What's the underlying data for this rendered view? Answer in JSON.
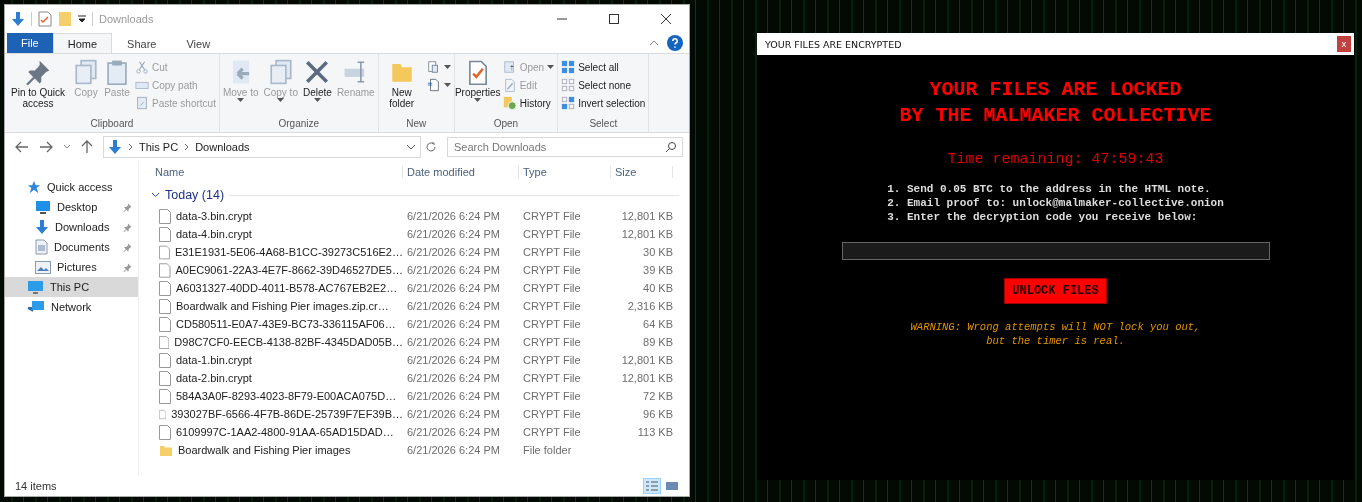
{
  "explorer": {
    "title": "Downloads",
    "tabs": [
      {
        "label": "File",
        "kind": "file",
        "selected": false
      },
      {
        "label": "Home",
        "kind": "tab",
        "selected": true
      },
      {
        "label": "Share",
        "kind": "tab",
        "selected": false
      },
      {
        "label": "View",
        "kind": "tab",
        "selected": false
      }
    ],
    "ribbon": [
      {
        "label": "Clipboard",
        "items": [
          {
            "kind": "large",
            "label": "Pin to Quick access",
            "disabled": false,
            "dropdown": false
          },
          {
            "kind": "large",
            "label": "Copy",
            "disabled": true,
            "dropdown": false
          },
          {
            "kind": "large",
            "label": "Paste",
            "disabled": true,
            "dropdown": false
          },
          {
            "kind": "small",
            "label": "Cut",
            "disabled": true,
            "dropdown": false
          },
          {
            "kind": "small",
            "label": "Copy path",
            "disabled": true,
            "dropdown": false
          },
          {
            "kind": "small",
            "label": "Paste shortcut",
            "disabled": true,
            "dropdown": false
          }
        ]
      },
      {
        "label": "Organize",
        "items": [
          {
            "kind": "large",
            "label": "Move to",
            "disabled": true,
            "dropdown": true
          },
          {
            "kind": "large",
            "label": "Copy to",
            "disabled": true,
            "dropdown": true
          },
          {
            "kind": "large",
            "label": "Delete",
            "disabled": false,
            "dropdown": true
          },
          {
            "kind": "large",
            "label": "Rename",
            "disabled": true,
            "dropdown": false
          }
        ]
      },
      {
        "label": "New",
        "items": [
          {
            "kind": "large",
            "label": "New folder",
            "disabled": false,
            "dropdown": false
          },
          {
            "kind": "icon",
            "disabled": false,
            "dropdown": true
          },
          {
            "kind": "icon",
            "disabled": false,
            "dropdown": true
          }
        ]
      },
      {
        "label": "Open",
        "items": [
          {
            "kind": "large",
            "label": "Properties",
            "disabled": false,
            "dropdown": true
          },
          {
            "kind": "small",
            "label": "Open",
            "disabled": true,
            "dropdown": true
          },
          {
            "kind": "small",
            "label": "Edit",
            "disabled": true,
            "dropdown": false
          },
          {
            "kind": "small",
            "label": "History",
            "disabled": false,
            "dropdown": false
          }
        ]
      },
      {
        "label": "Select",
        "items": [
          {
            "kind": "small",
            "label": "Select all",
            "disabled": false,
            "dropdown": false
          },
          {
            "kind": "small",
            "label": "Select none",
            "disabled": false,
            "dropdown": false
          },
          {
            "kind": "small",
            "label": "Invert selection",
            "disabled": false,
            "dropdown": false
          }
        ]
      }
    ],
    "address": {
      "crumbs": [
        "This PC",
        "Downloads"
      ]
    },
    "search": {
      "placeholder": "Search Downloads"
    },
    "nav": [
      {
        "label": "Quick access",
        "selected": false,
        "children": [
          {
            "label": "Desktop",
            "pinned": true,
            "selected": false
          },
          {
            "label": "Downloads",
            "pinned": true,
            "selected": false
          },
          {
            "label": "Documents",
            "pinned": true,
            "selected": false
          },
          {
            "label": "Pictures",
            "pinned": true,
            "selected": false
          }
        ]
      },
      {
        "label": "This PC",
        "selected": true
      },
      {
        "label": "Network",
        "selected": false
      }
    ],
    "columns": [
      "Name",
      "Date modified",
      "Type",
      "Size"
    ],
    "group": {
      "label": "Today (14)",
      "expanded": true
    },
    "rows": [
      {
        "kind": "file",
        "name": "data-3.bin.crypt",
        "date": "6/21/2026 6:24 PM",
        "type": "CRYPT File",
        "size": "12,801 KB"
      },
      {
        "kind": "file",
        "name": "data-4.bin.crypt",
        "date": "6/21/2026 6:24 PM",
        "type": "CRYPT File",
        "size": "12,801 KB"
      },
      {
        "kind": "file",
        "name": "E31E1931-5E06-4A68-B1CC-39273C516E2…",
        "date": "6/21/2026 6:24 PM",
        "type": "CRYPT File",
        "size": "30 KB"
      },
      {
        "kind": "file",
        "name": "A0EC9061-22A3-4E7F-8662-39D46527DE5…",
        "date": "6/21/2026 6:24 PM",
        "type": "CRYPT File",
        "size": "39 KB"
      },
      {
        "kind": "file",
        "name": "A6031327-40DD-4011-B578-AC767EB2E2…",
        "date": "6/21/2026 6:24 PM",
        "type": "CRYPT File",
        "size": "40 KB"
      },
      {
        "kind": "file",
        "name": "Boardwalk and Fishing Pier images.zip.cr…",
        "date": "6/21/2026 6:24 PM",
        "type": "CRYPT File",
        "size": "2,316 KB"
      },
      {
        "kind": "file",
        "name": "CD580511-E0A7-43E9-BC73-336115AF06…",
        "date": "6/21/2026 6:24 PM",
        "type": "CRYPT File",
        "size": "64 KB"
      },
      {
        "kind": "file",
        "name": "D98C7CF0-EECB-4138-82BF-4345DAD05B…",
        "date": "6/21/2026 6:24 PM",
        "type": "CRYPT File",
        "size": "89 KB"
      },
      {
        "kind": "file",
        "name": "data-1.bin.crypt",
        "date": "6/21/2026 6:24 PM",
        "type": "CRYPT File",
        "size": "12,801 KB"
      },
      {
        "kind": "file",
        "name": "data-2.bin.crypt",
        "date": "6/21/2026 6:24 PM",
        "type": "CRYPT File",
        "size": "12,801 KB"
      },
      {
        "kind": "file",
        "name": "584A3A0F-8293-4023-8F79-E00ACA075D…",
        "date": "6/21/2026 6:24 PM",
        "type": "CRYPT File",
        "size": "72 KB"
      },
      {
        "kind": "file",
        "name": "393027BF-6566-4F7B-86DE-25739F7EF39B…",
        "date": "6/21/2026 6:24 PM",
        "type": "CRYPT File",
        "size": "96 KB"
      },
      {
        "kind": "file",
        "name": "6109997C-1AA2-4800-91AA-65AD15DAD…",
        "date": "6/21/2026 6:24 PM",
        "type": "CRYPT File",
        "size": "113 KB"
      },
      {
        "kind": "folder",
        "name": "Boardwalk and Fishing Pier images",
        "date": "6/21/2026 6:24 PM",
        "type": "File folder"
      }
    ],
    "status_bar": {
      "text": "14 items",
      "views": [
        {
          "kind": "details",
          "selected": true
        },
        {
          "kind": "tiles",
          "selected": false
        }
      ]
    }
  },
  "note": {
    "title": "YOUR FILES ARE ENCRYPTED",
    "close": "x",
    "heading": [
      "YOUR FILES ARE LOCKED",
      "BY THE MALMAKER COLLECTIVE"
    ],
    "timer": "Time remaining: 47:59:43",
    "steps": [
      "1. Send 0.05 BTC to the address in the HTML note.",
      "2. Email proof to: unlock@malmaker-collective.onion",
      "3. Enter the decryption code you receive below:"
    ],
    "button": "UNLOCK FILES",
    "warning": [
      "WARNING: Wrong attempts will NOT lock you out,",
      "but the timer is real."
    ]
  }
}
